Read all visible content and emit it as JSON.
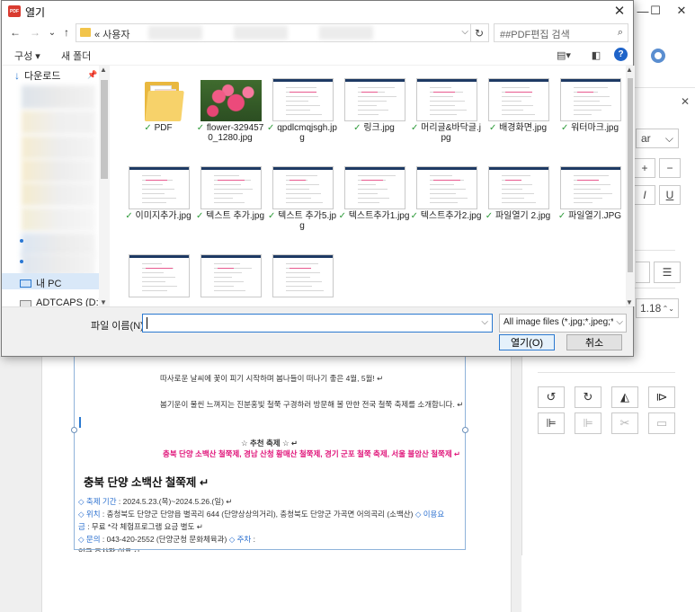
{
  "dialog": {
    "title": "열기",
    "logo_text": "PDF",
    "close_glyph": "✕"
  },
  "nav": {
    "back_glyph": "←",
    "forward_glyph": "→",
    "recent_glyph": "⌄",
    "up_glyph": "↑",
    "address_prefix": "« 사용자",
    "refresh_glyph": "↻",
    "search_placeholder": "##PDF편집 검색"
  },
  "toolbar": {
    "organize": "구성 ▾",
    "new_folder": "새 폴더",
    "help": "?"
  },
  "nav_pane": {
    "downloads": "다운로드",
    "this_pc": "내 PC",
    "drive": "ADTCAPS (D:)"
  },
  "files": [
    {
      "name": "PDF",
      "kind": "folder"
    },
    {
      "name": "flower-3294570_1280.jpg",
      "kind": "photo"
    },
    {
      "name": "qpdlcmqjsgh.jpg",
      "kind": "doc"
    },
    {
      "name": "링크.jpg",
      "kind": "doc"
    },
    {
      "name": "머리글&바닥글.jpg",
      "kind": "doc"
    },
    {
      "name": "배경화면.jpg",
      "kind": "doc"
    },
    {
      "name": "워터마크.jpg",
      "kind": "doc"
    },
    {
      "name": "이미지추가.jpg",
      "kind": "doc"
    },
    {
      "name": "텍스트 추가.jpg",
      "kind": "doc"
    },
    {
      "name": "텍스트 추가5.jpg",
      "kind": "doc"
    },
    {
      "name": "텍스트추가1.jpg",
      "kind": "doc"
    },
    {
      "name": "텍스트추가2.jpg",
      "kind": "doc"
    },
    {
      "name": "파일열기 2.jpg",
      "kind": "doc"
    },
    {
      "name": "파일열기.JPG",
      "kind": "doc"
    },
    {
      "name": "",
      "kind": "doc"
    },
    {
      "name": "",
      "kind": "doc"
    },
    {
      "name": "",
      "kind": "doc"
    }
  ],
  "bottom": {
    "filename_label": "파일 이름(N):",
    "filename_value": "",
    "filter": "All image files (*.jpg;*.jpeg;*.jp",
    "open": "열기(O)",
    "cancel": "취소"
  },
  "background_doc": {
    "line1": "따사로운 날씨에 꽃이 피기 시작하며 봄나들이 떠나기 좋은 4월, 5월! ↵",
    "line2": "봄기운이 물씬 느껴지는 진분홍빛 철쭉 구경하러 방문해 볼 만한 전국 철쭉 축제를 소개합니다. ↵",
    "recommend": "☆ 추천 축제 ☆ ↵",
    "festivals": "충북 단양 소백산 철쭉제, 경남 산청 황매산 철쭉제, 경기 군포 철쭉 축제, 서울 불암산 철쭉제 ↵",
    "heading": "충북 단양 소백산 철쭉제 ↵",
    "period_label": "◇ 축제 기간",
    "period_value": " : 2024.5.23.(목)~2024.5.26.(일) ↵",
    "loc_label": "◇ 위치",
    "loc_value": " : 충청북도 단양군 단양읍 별곡리 644 (단양상상의거리), 충청북도 단양군 가곡면 어의곡리 (소백산)",
    "fee_label": " ◇ 이용요",
    "fee_label2": "금",
    "fee_value": " : 무료 *각 체험프로그램 요금 별도 ↵",
    "contact_label": "◇ 문의",
    "contact_value": " : 043-420-2552 (단양군청 문화체육과)",
    "parking_label": " ◇ 주차",
    "parking_value": " :",
    "cut_line": "인근 주차장 이용 ↵"
  },
  "panel": {
    "font_size_value": "1.18",
    "font_name_partial": "ar"
  },
  "colors": {
    "accent": "#2b79d0",
    "pink_text": "#e0157a",
    "check_green": "#2e9b3a"
  }
}
